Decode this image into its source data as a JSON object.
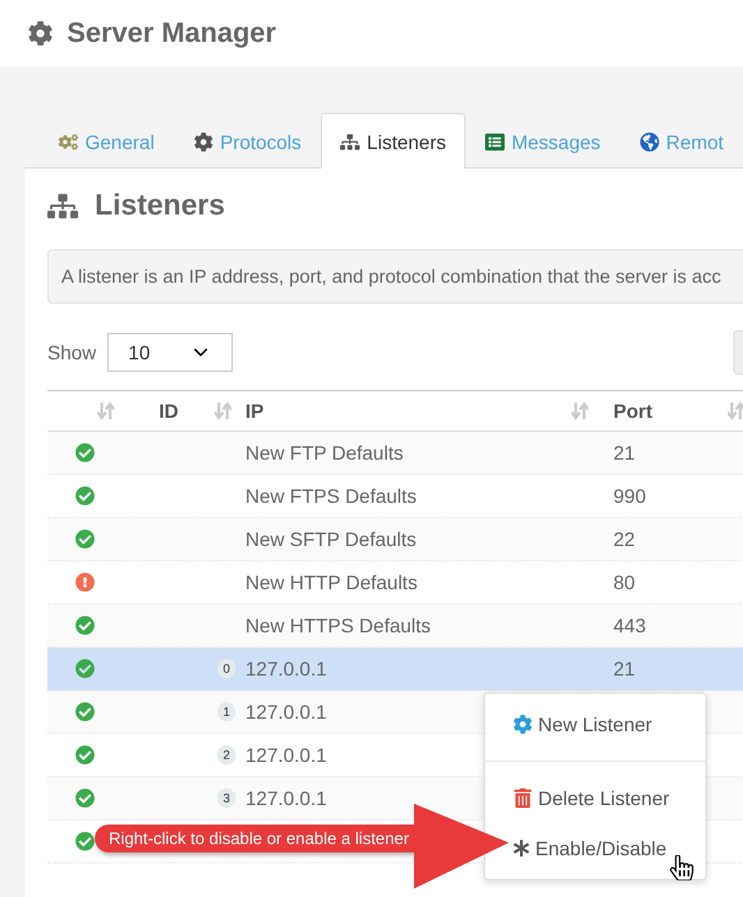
{
  "header": {
    "title": "Server Manager"
  },
  "tabs": [
    {
      "label": "General",
      "selected": false
    },
    {
      "label": "Protocols",
      "selected": false
    },
    {
      "label": "Listeners",
      "selected": true
    },
    {
      "label": "Messages",
      "selected": false
    },
    {
      "label": "Remot",
      "selected": false
    }
  ],
  "panel": {
    "title": "Listeners"
  },
  "info": "A listener is an IP address, port, and protocol combination that the server is acc",
  "show": {
    "label": "Show",
    "value": "10"
  },
  "table": {
    "columns": [
      "ID",
      "IP",
      "Port"
    ],
    "rows": [
      {
        "kind": "ok",
        "ip": "New FTP Defaults",
        "port": "21",
        "selected": false
      },
      {
        "kind": "ok",
        "ip": "New FTPS Defaults",
        "port": "990",
        "selected": false
      },
      {
        "kind": "ok",
        "ip": "New SFTP Defaults",
        "port": "22",
        "selected": false
      },
      {
        "kind": "warning",
        "ip": "New HTTP Defaults",
        "port": "80",
        "selected": false
      },
      {
        "kind": "ok",
        "ip": "New HTTPS Defaults",
        "port": "443",
        "selected": false
      },
      {
        "kind": "ok",
        "id": "0",
        "ip": "127.0.0.1",
        "port": "21",
        "selected": true
      },
      {
        "kind": "ok",
        "id": "1",
        "ip": "127.0.0.1",
        "selected": false
      },
      {
        "kind": "ok",
        "id": "2",
        "ip": "127.0.0.1",
        "selected": false
      },
      {
        "kind": "ok",
        "id": "3",
        "ip": "127.0.0.1",
        "selected": false
      },
      {
        "kind": "ok",
        "selected": false
      }
    ]
  },
  "context_menu": [
    {
      "label": "New Listener"
    },
    {
      "label": "Delete Listener"
    },
    {
      "label": "Enable/Disable"
    }
  ],
  "callout": "Right-click to disable or enable a listener"
}
